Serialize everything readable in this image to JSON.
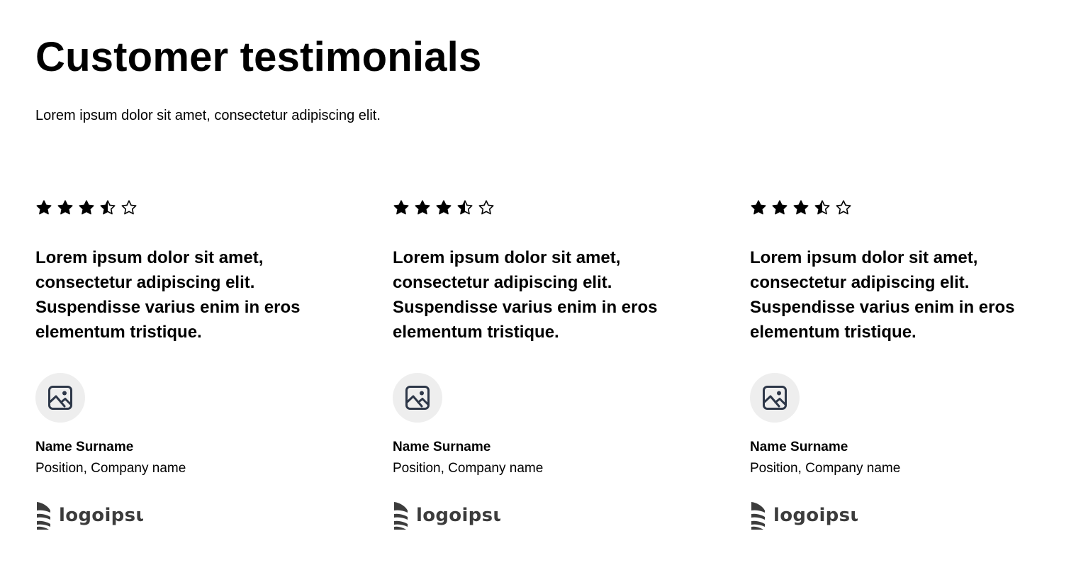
{
  "header": {
    "title": "Customer testimonials",
    "subtitle": "Lorem ipsum dolor sit amet, consectetur adipiscing elit."
  },
  "testimonials": [
    {
      "rating": 3.5,
      "rating_max": 5,
      "quote": "Lorem ipsum dolor sit amet, consectetur adipiscing elit. Suspendisse varius enim in eros elementum tristique.",
      "avatar_icon": "image-placeholder-icon",
      "name": "Name Surname",
      "position": "Position, Company name",
      "logo_text": "logoipsum"
    },
    {
      "rating": 3.5,
      "rating_max": 5,
      "quote": "Lorem ipsum dolor sit amet, consectetur adipiscing elit. Suspendisse varius enim in eros elementum tristique.",
      "avatar_icon": "image-placeholder-icon",
      "name": "Name Surname",
      "position": "Position, Company name",
      "logo_text": "logoipsum"
    },
    {
      "rating": 3.5,
      "rating_max": 5,
      "quote": "Lorem ipsum dolor sit amet, consectetur adipiscing elit. Suspendisse varius enim in eros elementum tristique.",
      "avatar_icon": "image-placeholder-icon",
      "name": "Name Surname",
      "position": "Position, Company name",
      "logo_text": "logoipsum"
    }
  ],
  "colors": {
    "text": "#000000",
    "avatar_bg": "#eeeeee",
    "icon": "#2d3748",
    "logo": "#3c3c3c"
  }
}
